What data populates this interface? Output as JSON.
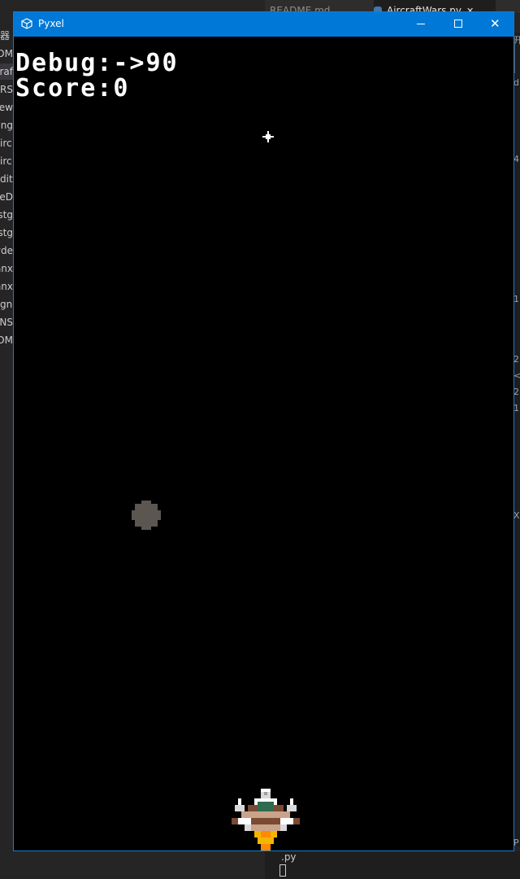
{
  "editor": {
    "tabs": [
      {
        "label": "README.md"
      },
      {
        "label": "AircraftWars.py",
        "close": "✕"
      }
    ],
    "explorer_items": [
      "器",
      "IDM",
      "raf",
      "ARS",
      "new",
      "png",
      "irc",
      "irc",
      "dit",
      "reD",
      "rstg",
      "rstg",
      "vde",
      "anx",
      "anx",
      "gn",
      "ENS",
      "DM"
    ],
    "bottom_label": ".py",
    "gutter_glyphs": [
      "开",
      "d",
      "4",
      "1",
      "2",
      "<",
      "2",
      "1",
      "X",
      "P"
    ]
  },
  "window": {
    "title": "Pyxel",
    "icon": "pyxel-cube-icon",
    "controls": {
      "minimize": "minimize-icon",
      "maximize": "maximize-icon",
      "close_glyph": "✕"
    },
    "accent": "#0078d7"
  },
  "game": {
    "debug_text": "Debug:->90",
    "score_text": "Score:0",
    "background": "#000000",
    "sprites": {
      "sparkle": "sparkle-icon",
      "enemy": "enemy-bullet-icon",
      "player": "player-aircraft-icon"
    }
  }
}
